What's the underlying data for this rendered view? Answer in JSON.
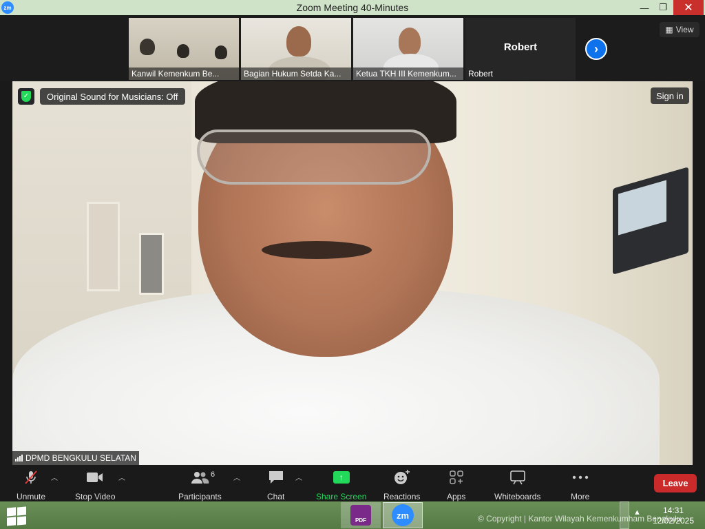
{
  "window": {
    "app_icon": "zm",
    "title": "Zoom Meeting 40-Minutes",
    "minimize": "—",
    "maximize": "❐",
    "close": "✕"
  },
  "gallery": {
    "participants": [
      {
        "name": "Kanwil Kemenkum Be..."
      },
      {
        "name": "Bagian Hukum Setda Ka..."
      },
      {
        "name": "Ketua TKH III Kemenkum..."
      },
      {
        "name": "Robert",
        "display": "Robert"
      }
    ],
    "next_icon": "›",
    "view_label": "View"
  },
  "main_video": {
    "sound_badge": "Original Sound for Musicians: Off",
    "sign_in": "Sign in",
    "speaker_name": "DPMD BENGKULU SELATAN"
  },
  "toolbar": {
    "unmute": "Unmute",
    "stop_video": "Stop Video",
    "participants": "Participants",
    "participants_count": "6",
    "chat": "Chat",
    "share_screen": "Share Screen",
    "reactions": "Reactions",
    "apps": "Apps",
    "whiteboards": "Whiteboards",
    "more": "More",
    "leave": "Leave"
  },
  "taskbar": {
    "pdf_label": "PDF",
    "zoom_label": "zm",
    "copyright": "© Copyright | Kantor Wilayah Kemenkumham Bengkulu",
    "time": "14:31",
    "date": "12/02/2025"
  },
  "colors": {
    "accent_blue": "#0e72ed",
    "share_green": "#23d959",
    "leave_red": "#cb2a2a"
  }
}
